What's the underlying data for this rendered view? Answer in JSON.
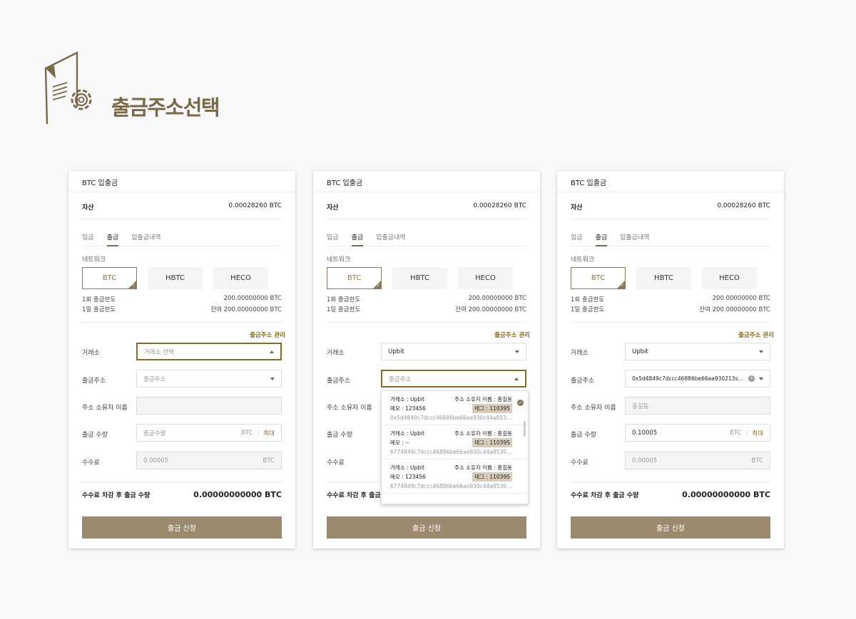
{
  "page": {
    "title": "출금주소선택"
  },
  "colors": {
    "accent": "#8a6a1c",
    "brand": "#7a6848",
    "button": "#9d8a6e"
  },
  "cards": [
    {
      "title": "BTC 입출금",
      "asset_label": "자산",
      "asset_value": "0.00028260 BTC",
      "tabs": [
        "입금",
        "출금",
        "입출금내역"
      ],
      "network_label": "네트워크",
      "networks": [
        "BTC",
        "HBTC",
        "HECO"
      ],
      "limit_once_label": "1회 출금한도",
      "limit_once_value": "200.00000000 BTC",
      "limit_day_label": "1일 출금한도",
      "limit_day_value": "잔여 200.00000000 BTC",
      "mgmt_link": "출금주소 관리",
      "exchange_label": "거래소",
      "exchange_value": "거래소 선택",
      "address_label": "출금주소",
      "address_value": "출금주소",
      "owner_label": "주소 소유자 이름",
      "owner_value": "",
      "amount_label": "출금 수량",
      "amount_value": "출금수량",
      "amount_unit": "BTC",
      "max_label": "최대",
      "fee_label": "수수료",
      "fee_value": "0.00005",
      "fee_unit": "BTC",
      "total_label": "수수료 차감 후 출금 수량",
      "total_value": "0.00000000000 BTC",
      "submit_label": "출금 신청"
    },
    {
      "title": "BTC 입출금",
      "asset_label": "자산",
      "asset_value": "0.00028260 BTC",
      "tabs": [
        "입금",
        "출금",
        "입출금내역"
      ],
      "network_label": "네트워크",
      "networks": [
        "BTC",
        "HBTC",
        "HECO"
      ],
      "limit_once_label": "1회 출금한도",
      "limit_once_value": "200.00000000 BTC",
      "limit_day_label": "1일 출금한도",
      "limit_day_value": "잔여 200.00000000 BTC",
      "mgmt_link": "출금주소 관리",
      "exchange_label": "거래소",
      "exchange_value": "Upbit",
      "address_label": "출금주소",
      "address_value": "출금주소",
      "owner_label": "주소 소유자 이름",
      "amount_label": "출금 수량",
      "fee_label": "수수료",
      "total_label": "수수료 차감 후 출금 수량",
      "submit_label": "출금 신청",
      "dropdown": [
        {
          "exchange": "거래소 : Upbit",
          "owner": "주소 소유자 이름 : 홍길동",
          "memo": "메모 : 123456",
          "tag": "태그 : 110395",
          "address": "0x5d4849c7dccc46886be66aa930c44a853082..."
        },
        {
          "exchange": "거래소 : Upbit",
          "owner": "주소 소유자 이름 : 홍길동",
          "memo": "메모 : --",
          "tag": "태그 : 110395",
          "address": "6774849c7dccc46886be66aa930c44a8530782..."
        },
        {
          "exchange": "거래소 : Upbit",
          "owner": "주소 소유자 이름 : 홍길동",
          "memo": "메모 : 123456",
          "tag": "태그 : 110395",
          "address": "6774849c7dccc46886be66aa930c44a8530782..."
        }
      ]
    },
    {
      "title": "BTC 입출금",
      "asset_label": "자산",
      "asset_value": "0.00028260 BTC",
      "tabs": [
        "입금",
        "출금",
        "입출금내역"
      ],
      "network_label": "네트워크",
      "networks": [
        "BTC",
        "HBTC",
        "HECO"
      ],
      "limit_once_label": "1회 출금한도",
      "limit_once_value": "200.00000000 BTC",
      "limit_day_label": "1일 출금한도",
      "limit_day_value": "잔여 200.00000000 BTC",
      "mgmt_link": "출금주소 관리",
      "exchange_label": "거래소",
      "exchange_value": "Upbit",
      "address_label": "출금주소",
      "address_value": "0x5d4849c7dccc46886be66aa930213ssasd...",
      "owner_label": "주소 소유자 이름",
      "owner_value": "홍길동",
      "amount_label": "출금 수량",
      "amount_value": "0.10005",
      "amount_unit": "BTC",
      "max_label": "최대",
      "fee_label": "수수료",
      "fee_value": "0.00005",
      "fee_unit": "BTC",
      "total_label": "수수료 차감 후 출금 수량",
      "total_value": "0.00000000000 BTC",
      "submit_label": "출금 신청"
    }
  ]
}
